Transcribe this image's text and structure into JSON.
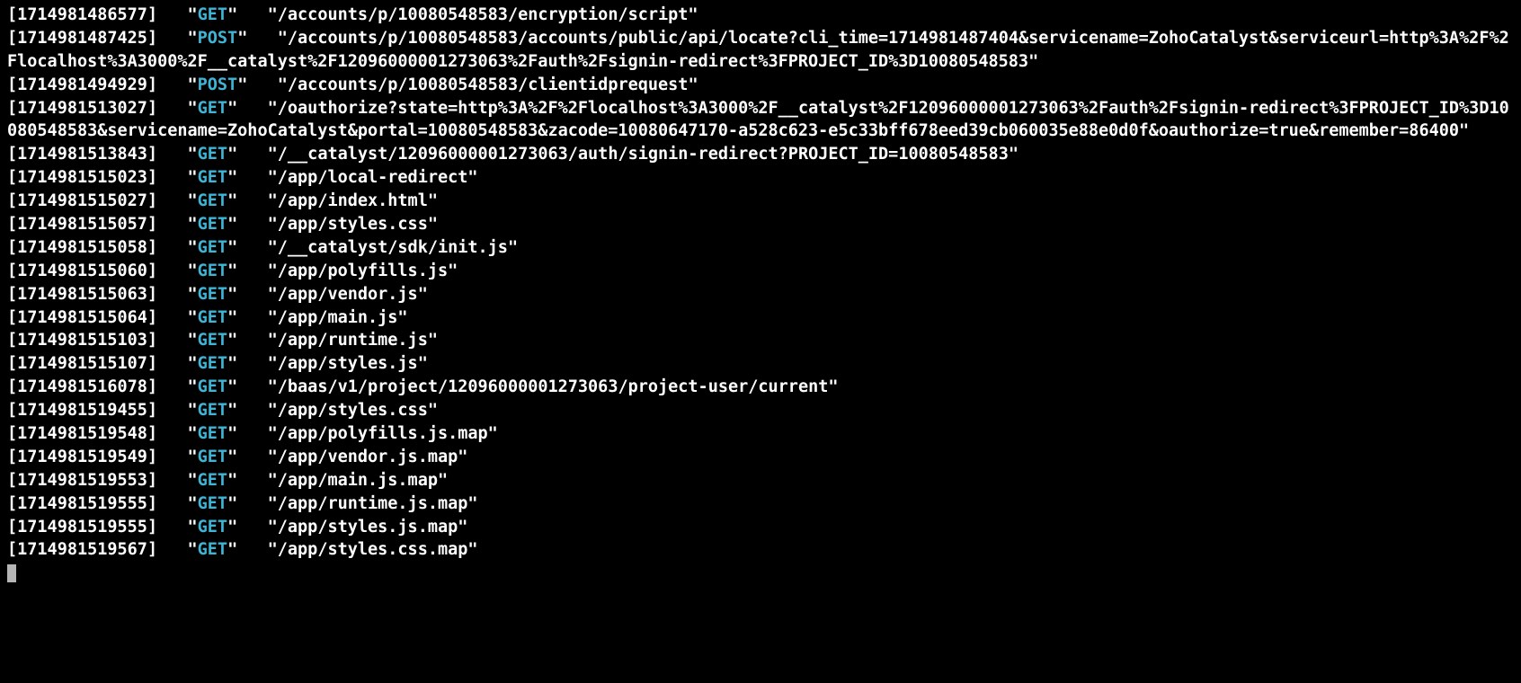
{
  "colors": {
    "background": "#000000",
    "text": "#ffffff",
    "method": "#3fb5d6",
    "cursor": "#b5b5b5"
  },
  "logs": [
    {
      "timestamp": "1714981486577",
      "method": "GET",
      "path": "/accounts/p/10080548583/encryption/script"
    },
    {
      "timestamp": "1714981487425",
      "method": "POST",
      "path": "/accounts/p/10080548583/accounts/public/api/locate?cli_time=1714981487404&servicename=ZohoCatalyst&serviceurl=http%3A%2F%2Flocalhost%3A3000%2F__catalyst%2F12096000001273063%2Fauth%2Fsignin-redirect%3FPROJECT_ID%3D10080548583"
    },
    {
      "timestamp": "1714981494929",
      "method": "POST",
      "path": "/accounts/p/10080548583/clientidprequest"
    },
    {
      "timestamp": "1714981513027",
      "method": "GET",
      "path": "/oauthorize?state=http%3A%2F%2Flocalhost%3A3000%2F__catalyst%2F12096000001273063%2Fauth%2Fsignin-redirect%3FPROJECT_ID%3D10080548583&servicename=ZohoCatalyst&portal=10080548583&zacode=10080647170-a528c623-e5c33bff678eed39cb060035e88e0d0f&oauthorize=true&remember=86400"
    },
    {
      "timestamp": "1714981513843",
      "method": "GET",
      "path": "/__catalyst/12096000001273063/auth/signin-redirect?PROJECT_ID=10080548583"
    },
    {
      "timestamp": "1714981515023",
      "method": "GET",
      "path": "/app/local-redirect"
    },
    {
      "timestamp": "1714981515027",
      "method": "GET",
      "path": "/app/index.html"
    },
    {
      "timestamp": "1714981515057",
      "method": "GET",
      "path": "/app/styles.css"
    },
    {
      "timestamp": "1714981515058",
      "method": "GET",
      "path": "/__catalyst/sdk/init.js"
    },
    {
      "timestamp": "1714981515060",
      "method": "GET",
      "path": "/app/polyfills.js"
    },
    {
      "timestamp": "1714981515063",
      "method": "GET",
      "path": "/app/vendor.js"
    },
    {
      "timestamp": "1714981515064",
      "method": "GET",
      "path": "/app/main.js"
    },
    {
      "timestamp": "1714981515103",
      "method": "GET",
      "path": "/app/runtime.js"
    },
    {
      "timestamp": "1714981515107",
      "method": "GET",
      "path": "/app/styles.js"
    },
    {
      "timestamp": "1714981516078",
      "method": "GET",
      "path": "/baas/v1/project/12096000001273063/project-user/current"
    },
    {
      "timestamp": "1714981519455",
      "method": "GET",
      "path": "/app/styles.css"
    },
    {
      "timestamp": "1714981519548",
      "method": "GET",
      "path": "/app/polyfills.js.map"
    },
    {
      "timestamp": "1714981519549",
      "method": "GET",
      "path": "/app/vendor.js.map"
    },
    {
      "timestamp": "1714981519553",
      "method": "GET",
      "path": "/app/main.js.map"
    },
    {
      "timestamp": "1714981519555",
      "method": "GET",
      "path": "/app/runtime.js.map"
    },
    {
      "timestamp": "1714981519555",
      "method": "GET",
      "path": "/app/styles.js.map"
    },
    {
      "timestamp": "1714981519567",
      "method": "GET",
      "path": "/app/styles.css.map"
    }
  ],
  "glyphs": {
    "open_bracket": "[",
    "close_bracket": "]",
    "quote": "\"",
    "gap_after_ts": "   ",
    "gap_after_method_get": "   ",
    "gap_after_method_post": "   "
  }
}
